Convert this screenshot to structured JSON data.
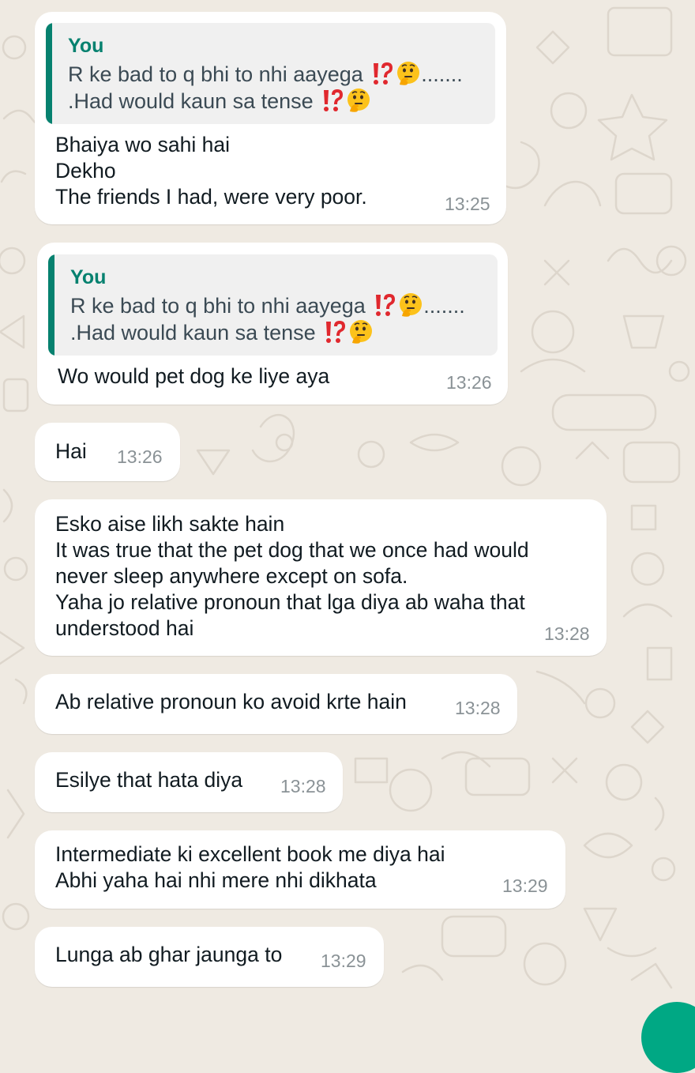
{
  "chat": {
    "colors": {
      "wallpaper": "#efeae2",
      "bubble": "#ffffff",
      "quote_bar": "#06816f",
      "quote_author": "#06816f",
      "quote_bg": "#f0f0f0",
      "timestamp": "#8a9296"
    },
    "messages": [
      {
        "reply": {
          "author": "You",
          "line1": "R ke bad to q bhi to nhi aayega",
          "line1_suffix": ".......",
          "line2": ".Had would kaun sa tense",
          "emojis": [
            "exclamation-question-icon",
            "thinking-face-icon"
          ]
        },
        "lines": [
          "Bhaiya wo sahi hai",
          "Dekho",
          "The friends I had, were very poor."
        ],
        "time": "13:25"
      },
      {
        "reply": {
          "author": "You",
          "line1": "R ke bad to q bhi to nhi aayega",
          "line1_suffix": ".......",
          "line2": ".Had would kaun sa tense",
          "emojis": [
            "exclamation-question-icon",
            "thinking-face-icon"
          ]
        },
        "lines": [
          "Wo would pet dog ke liye aya"
        ],
        "time": "13:26"
      },
      {
        "lines": [
          "Hai"
        ],
        "time": "13:26"
      },
      {
        "lines": [
          "Esko aise likh sakte hain",
          "It was true that the pet dog that we once had would",
          "never sleep anywhere except on sofa.",
          "Yaha jo relative pronoun that lga diya ab waha that",
          "understood hai"
        ],
        "time": "13:28"
      },
      {
        "lines": [
          "Ab relative pronoun ko avoid krte hain"
        ],
        "time": "13:28"
      },
      {
        "lines": [
          "Esilye that hata diya"
        ],
        "time": "13:28"
      },
      {
        "lines": [
          "Intermediate ki excellent book me diya hai",
          "Abhi yaha hai nhi mere nhi dikhata"
        ],
        "time": "13:29"
      },
      {
        "lines": [
          "Lunga ab ghar jaunga to"
        ],
        "time": "13:29"
      }
    ]
  }
}
